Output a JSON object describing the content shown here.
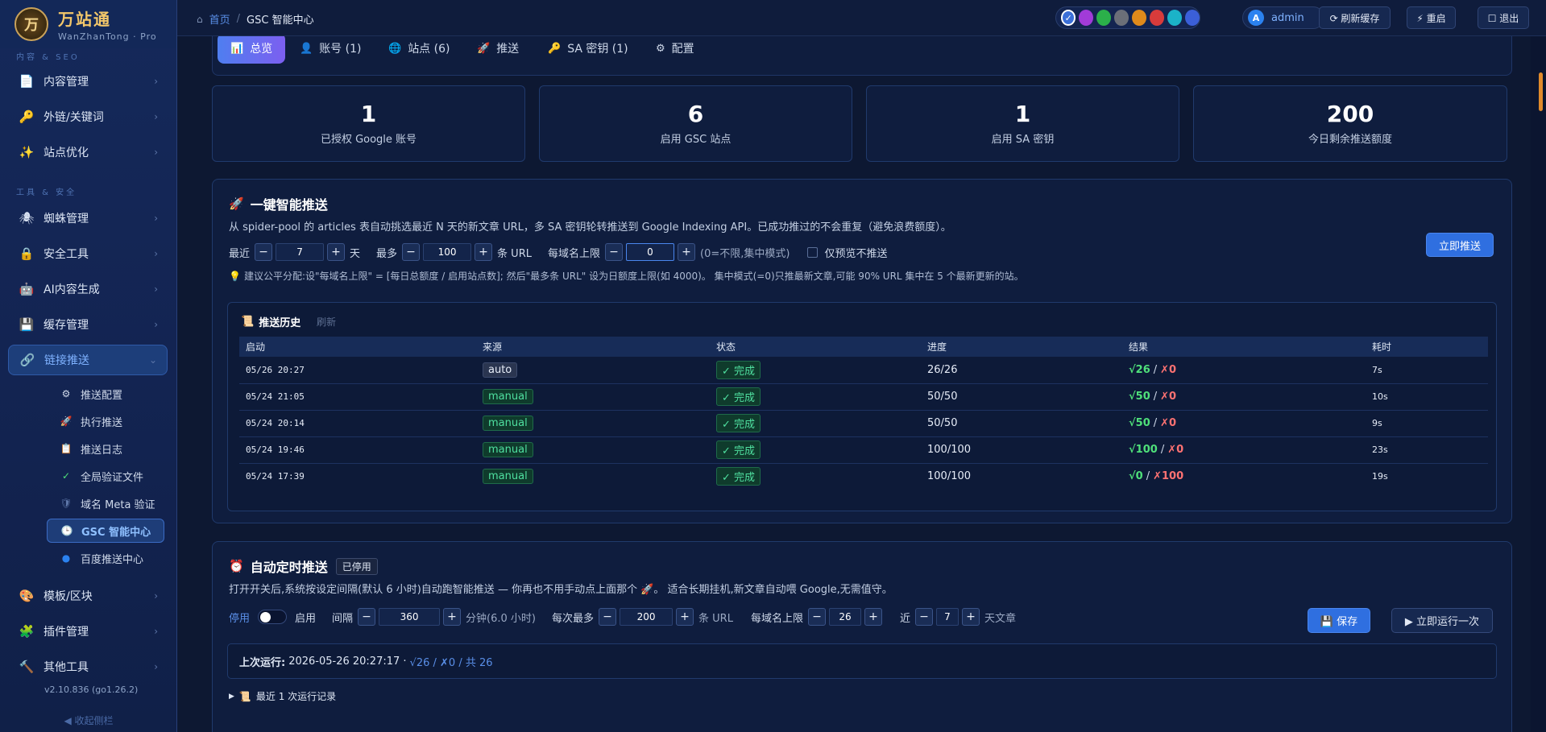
{
  "brand": {
    "name": "万站通",
    "sub": "WanZhanTong · Pro",
    "logo_glyph": "万"
  },
  "sidebar": {
    "section_content": "内容 & SEO",
    "section_tools": "工具 & 安全",
    "items": [
      {
        "label": "内容管理",
        "icon": "📄"
      },
      {
        "label": "外链/关键词",
        "icon": "🔑"
      },
      {
        "label": "站点优化",
        "icon": "✨"
      },
      {
        "label": "蜘蛛管理",
        "icon": "🕷"
      },
      {
        "label": "安全工具",
        "icon": "🔒"
      },
      {
        "label": "AI内容生成",
        "icon": "🤖"
      },
      {
        "label": "缓存管理",
        "icon": "💾"
      },
      {
        "label": "链接推送",
        "icon": "🔗"
      }
    ],
    "sub_items": [
      {
        "label": "推送配置",
        "icon": "⚙"
      },
      {
        "label": "执行推送",
        "icon": "🚀"
      },
      {
        "label": "推送日志",
        "icon": "📋"
      },
      {
        "label": "全局验证文件",
        "icon": "✓"
      },
      {
        "label": "域名 Meta 验证",
        "icon": "🛡"
      },
      {
        "label": "GSC 智能中心",
        "icon": "🕒"
      },
      {
        "label": "百度推送中心",
        "icon": "●"
      }
    ],
    "bottom_items": [
      {
        "label": "模板/区块",
        "icon": "🎨"
      },
      {
        "label": "插件管理",
        "icon": "🧩"
      },
      {
        "label": "其他工具",
        "icon": "🔨"
      }
    ],
    "version": "v2.10.836 (go1.26.2)",
    "collapse": "◀ 收起侧栏"
  },
  "topbar": {
    "home_icon": "⌂",
    "crumb_home": "首页",
    "crumb_sep": "/",
    "crumb_current": "GSC 智能中心",
    "theme_colors": [
      "#3b6fd8",
      "#a13bd8",
      "#2bb04a",
      "#6b6f78",
      "#e08a1b",
      "#d83b3b",
      "#1bb3c8",
      "#3b5fd8"
    ],
    "admin_initial": "A",
    "admin_label": "admin",
    "refresh_cache": "⟳ 刷新缓存",
    "restart": "⚡ 重启",
    "logout": "☐ 退出"
  },
  "tabs": [
    {
      "label": "总览",
      "icon": "📊"
    },
    {
      "label": "账号 (1)",
      "icon": "👤"
    },
    {
      "label": "站点 (6)",
      "icon": "🌐"
    },
    {
      "label": "推送",
      "icon": "🚀"
    },
    {
      "label": "SA 密钥 (1)",
      "icon": "🔑"
    },
    {
      "label": "配置",
      "icon": "⚙"
    }
  ],
  "stats": [
    {
      "value": "1",
      "label": "已授权 Google 账号"
    },
    {
      "value": "6",
      "label": "启用 GSC 站点"
    },
    {
      "value": "1",
      "label": "启用 SA 密钥"
    },
    {
      "value": "200",
      "label": "今日剩余推送额度"
    }
  ],
  "smart_push": {
    "icon": "🚀",
    "title": "一键智能推送",
    "desc": "从 spider-pool 的 articles 表自动挑选最近 N 天的新文章 URL，多 SA 密钥轮转推送到 Google Indexing API。已成功推过的不会重复（避免浪费额度）。",
    "recent_label": "最近",
    "days_value": "7",
    "days_unit": "天",
    "max_label": "最多",
    "max_value": "100",
    "max_unit": "条 URL",
    "per_domain_label": "每域名上限",
    "per_domain_value": "0",
    "per_domain_hint": "(0=不限,集中模式)",
    "preview_label": "仅预览不推送",
    "push_now": "立即推送",
    "tip_icon": "💡",
    "tip": "建议公平分配:设\"每域名上限\" = [每日总额度 / 启用站点数]; 然后\"最多条 URL\" 设为日额度上限(如 4000)。 集中模式(=0)只推最新文章,可能 90% URL 集中在 5 个最新更新的站。",
    "minus": "−",
    "plus": "+"
  },
  "history": {
    "icon": "📜",
    "title": "推送历史",
    "refresh": "刷新",
    "columns": [
      "启动",
      "来源",
      "状态",
      "进度",
      "结果",
      "耗时"
    ],
    "rows": [
      {
        "time": "05/26 20:27",
        "source": "auto",
        "status": "✓ 完成",
        "progress": "26/26",
        "ok": "√26",
        "fail": "✗0",
        "dur": "7s"
      },
      {
        "time": "05/24 21:05",
        "source": "manual",
        "status": "✓ 完成",
        "progress": "50/50",
        "ok": "√50",
        "fail": "✗0",
        "dur": "10s"
      },
      {
        "time": "05/24 20:14",
        "source": "manual",
        "status": "✓ 完成",
        "progress": "50/50",
        "ok": "√50",
        "fail": "✗0",
        "dur": "9s"
      },
      {
        "time": "05/24 19:46",
        "source": "manual",
        "status": "✓ 完成",
        "progress": "100/100",
        "ok": "√100",
        "fail": "✗0",
        "dur": "23s"
      },
      {
        "time": "05/24 17:39",
        "source": "manual",
        "status": "✓ 完成",
        "progress": "100/100",
        "ok": "√0",
        "fail": "✗100",
        "dur": "19s"
      }
    ]
  },
  "auto_push": {
    "icon": "⏰",
    "title": "自动定时推送",
    "badge": "已停用",
    "desc": "打开开关后,系统按设定间隔(默认 6 小时)自动跑智能推送 — 你再也不用手动点上面那个 🚀。 适合长期挂机,新文章自动喂 Google,无需值守。",
    "off_label": "停用",
    "on_label": "启用",
    "interval_label": "间隔",
    "interval_value": "360",
    "interval_unit": "分钟(6.0 小时)",
    "per_run_label": "每次最多",
    "per_run_value": "200",
    "per_run_unit": "条 URL",
    "per_domain_label": "每域名上限",
    "per_domain_value": "26",
    "recent_label": "近",
    "recent_value": "7",
    "recent_unit": "天文章",
    "save": "💾 保存",
    "run_once": "▶ 立即运行一次",
    "last_run_label": "上次运行:",
    "last_run_time": "2026-05-26 20:27:17 ·",
    "last_run_result": "√26 / ✗0 / 共 26",
    "recent_runs": "最近 1 次运行记录",
    "recent_arrow": "▶",
    "recent_icon": "📜"
  }
}
